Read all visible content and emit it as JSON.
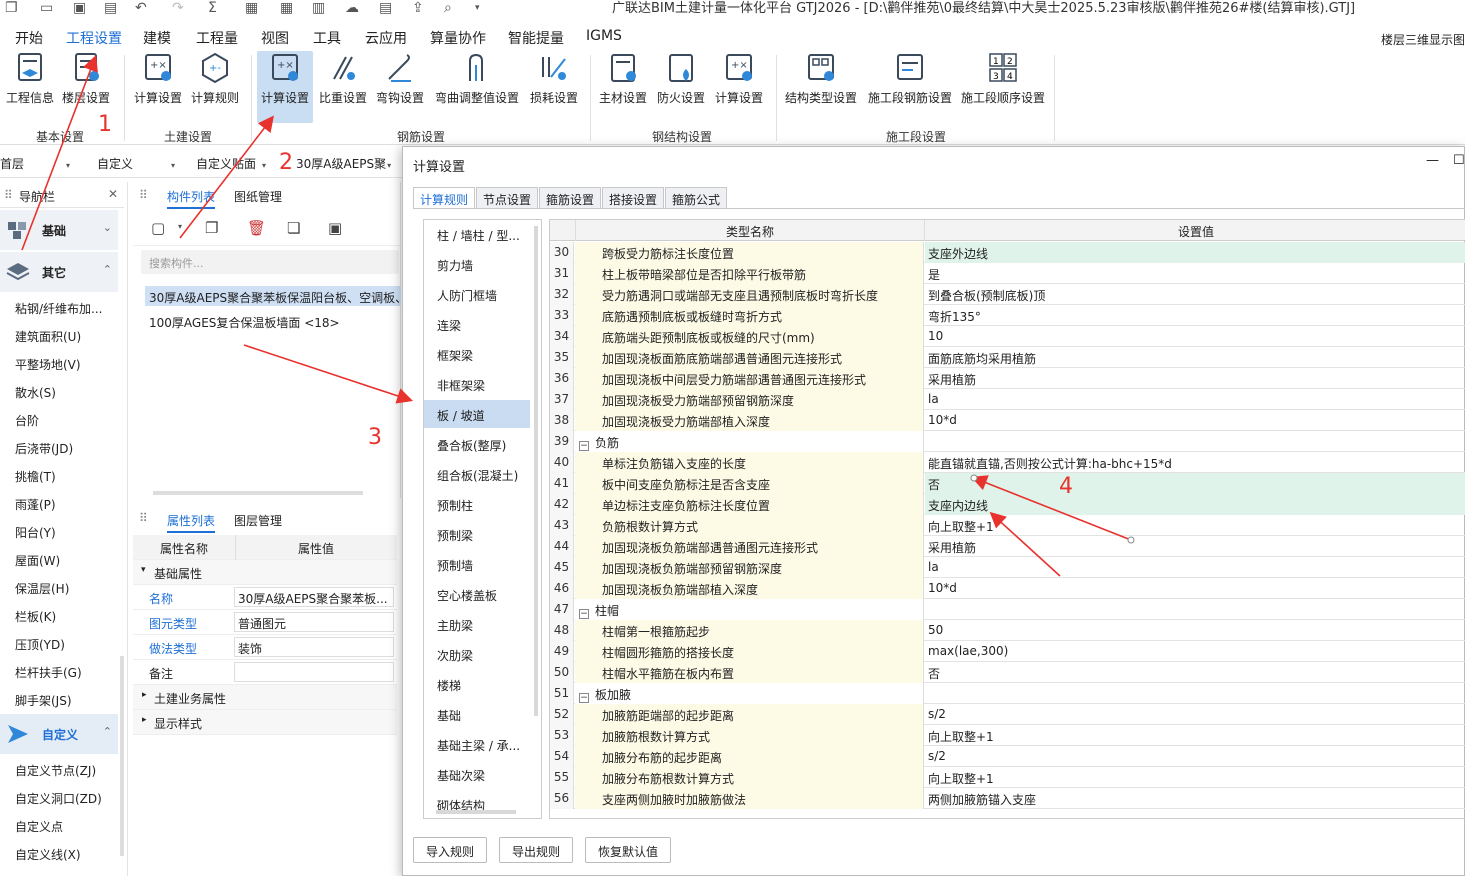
{
  "window": {
    "title": "广联达BIM土建计量一体化平台 GTJ2026 - [D:\\鹳伴推苑\\0最终结算\\中大昊士2025.5.23审核版\\鹳伴推苑26#楼(结算审核).GTJ]"
  },
  "menubar": {
    "items": [
      "开始",
      "工程设置",
      "建模",
      "工程量",
      "视图",
      "工具",
      "云应用",
      "算量协作",
      "智能提量",
      "IGMS"
    ],
    "active": "工程设置",
    "corner": "楼层三维显示图"
  },
  "ribbon": {
    "buttons": [
      {
        "label": "工程信息",
        "icon": "project-info-icon"
      },
      {
        "label": "楼层设置",
        "icon": "floor-settings-icon"
      },
      {
        "label": "计算设置",
        "icon": "calc-settings-icon"
      },
      {
        "label": "计算规则",
        "icon": "calc-rules-icon"
      },
      {
        "label": "计算设置",
        "icon": "rebar-calc-settings-icon"
      },
      {
        "label": "比重设置",
        "icon": "density-settings-icon"
      },
      {
        "label": "弯钩设置",
        "icon": "hook-settings-icon"
      },
      {
        "label": "弯曲调整值设置",
        "icon": "bend-adjust-icon"
      },
      {
        "label": "损耗设置",
        "icon": "loss-settings-icon"
      },
      {
        "label": "主材设置",
        "icon": "main-material-icon"
      },
      {
        "label": "防火设置",
        "icon": "fire-settings-icon"
      },
      {
        "label": "计算设置",
        "icon": "steel-calc-settings-icon"
      },
      {
        "label": "结构类型设置",
        "icon": "structure-type-icon"
      },
      {
        "label": "施工段钢筋设置",
        "icon": "segment-rebar-icon"
      },
      {
        "label": "施工段顺序设置",
        "icon": "segment-order-icon"
      }
    ],
    "groups": [
      "基本设置",
      "土建设置",
      "钢筋设置",
      "钢结构设置",
      "施工段设置"
    ]
  },
  "toolbar2": {
    "floor": "首层",
    "custom": "自定义",
    "custom_face": "自定义贴面",
    "component": "30厚A级AEPS聚"
  },
  "nav": {
    "title": "导航栏",
    "group1": "基础",
    "group2": "其它",
    "items": [
      "粘钢/纤维布加...",
      "建筑面积(U)",
      "平整场地(V)",
      "散水(S)",
      "台阶",
      "后浇带(JD)",
      "挑檐(T)",
      "雨蓬(P)",
      "阳台(Y)",
      "屋面(W)",
      "保温层(H)",
      "栏板(K)",
      "压顶(YD)",
      "栏杆扶手(G)",
      "脚手架(JS)"
    ],
    "group3": "自定义",
    "items2": [
      "自定义节点(ZJ)",
      "自定义洞口(ZD)",
      "自定义点",
      "自定义线(X)"
    ]
  },
  "components": {
    "tab1": "构件列表",
    "tab2": "图纸管理",
    "search_placeholder": "搜索构件...",
    "items": [
      "30厚A级AEPS聚合聚苯板保温阳台板、空调板、",
      "100厚AGES复合保温板墙面 <18>"
    ]
  },
  "properties": {
    "tab1": "属性列表",
    "tab2": "图层管理",
    "col1": "属性名称",
    "col2": "属性值",
    "section": "基础属性",
    "rows": [
      {
        "name": "名称",
        "value": "30厚A级AEPS聚合聚苯板..."
      },
      {
        "name": "图元类型",
        "value": "普通图元"
      },
      {
        "name": "做法类型",
        "value": "装饰"
      },
      {
        "name": "备注",
        "value": ""
      }
    ],
    "sections2": [
      "土建业务属性",
      "显示样式"
    ]
  },
  "dialog": {
    "title": "计算设置",
    "tabs": [
      "计算规则",
      "节点设置",
      "箍筋设置",
      "搭接设置",
      "箍筋公式"
    ],
    "categories": [
      "柱 / 墙柱 / 型...",
      "剪力墙",
      "人防门框墙",
      "连梁",
      "框架梁",
      "非框架梁",
      "板 / 坡道",
      "叠合板(整厚)",
      "组合板(混凝土)",
      "预制柱",
      "预制梁",
      "预制墙",
      "空心楼盖板",
      "主肋梁",
      "次肋梁",
      "楼梯",
      "基础",
      "基础主梁 / 承...",
      "基础次梁",
      "砌体结构"
    ],
    "selected_category": "板 / 坡道",
    "col_name": "类型名称",
    "col_value": "设置值",
    "rows": [
      {
        "n": "30",
        "name": "跨板受力筋标注长度位置",
        "value": "支座外边线",
        "hl": true
      },
      {
        "n": "31",
        "name": "柱上板带暗梁部位是否扣除平行板带筋",
        "value": "是"
      },
      {
        "n": "32",
        "name": "受力筋遇洞口或端部无支座且遇预制底板时弯折长度",
        "value": "到叠合板(预制底板)顶"
      },
      {
        "n": "33",
        "name": "底筋遇预制底板或板缝时弯折方式",
        "value": "弯折135°"
      },
      {
        "n": "34",
        "name": "底筋端头距预制底板或板缝的尺寸(mm)",
        "value": "10"
      },
      {
        "n": "35",
        "name": "加固现浇板面筋底筋端部遇普通图元连接形式",
        "value": "面筋底筋均采用植筋"
      },
      {
        "n": "36",
        "name": "加固现浇板中间层受力筋端部遇普通图元连接形式",
        "value": "采用植筋"
      },
      {
        "n": "37",
        "name": "加固现浇板受力筋端部预留钢筋深度",
        "value": "la"
      },
      {
        "n": "38",
        "name": "加固现浇板受力筋端部植入深度",
        "value": "10*d"
      },
      {
        "n": "39",
        "name": "负筋",
        "value": "",
        "group": true
      },
      {
        "n": "40",
        "name": "单标注负筋锚入支座的长度",
        "value": "能直锚就直锚,否则按公式计算:ha-bhc+15*d"
      },
      {
        "n": "41",
        "name": "板中间支座负筋标注是否含支座",
        "value": "否",
        "hl": true
      },
      {
        "n": "42",
        "name": "单边标注支座负筋标注长度位置",
        "value": "支座内边线",
        "hl": true
      },
      {
        "n": "43",
        "name": "负筋根数计算方式",
        "value": "向上取整+1"
      },
      {
        "n": "44",
        "name": "加固现浇板负筋端部遇普通图元连接形式",
        "value": "采用植筋"
      },
      {
        "n": "45",
        "name": "加固现浇板负筋端部预留钢筋深度",
        "value": "la"
      },
      {
        "n": "46",
        "name": "加固现浇板负筋端部植入深度",
        "value": "10*d"
      },
      {
        "n": "47",
        "name": "柱帽",
        "value": "",
        "group": true
      },
      {
        "n": "48",
        "name": "柱帽第一根箍筋起步",
        "value": "50"
      },
      {
        "n": "49",
        "name": "柱帽圆形箍筋的搭接长度",
        "value": "max(lae,300)"
      },
      {
        "n": "50",
        "name": "柱帽水平箍筋在板内布置",
        "value": "否"
      },
      {
        "n": "51",
        "name": "板加腋",
        "value": "",
        "group": true
      },
      {
        "n": "52",
        "name": "加腋筋距端部的起步距离",
        "value": "s/2"
      },
      {
        "n": "53",
        "name": "加腋筋根数计算方式",
        "value": "向上取整+1"
      },
      {
        "n": "54",
        "name": "加腋分布筋的起步距离",
        "value": "s/2"
      },
      {
        "n": "55",
        "name": "加腋分布筋根数计算方式",
        "value": "向上取整+1"
      },
      {
        "n": "56",
        "name": "支座两侧加腋时加腋筋做法",
        "value": "两侧加腋筋锚入支座"
      }
    ],
    "footer": [
      "导入规则",
      "导出规则",
      "恢复默认值"
    ]
  },
  "annotations": [
    "1",
    "2",
    "3",
    "4"
  ],
  "colors": {
    "accent": "#1e6fd6",
    "annotation": "#e8322d",
    "highlight": "#dff3ea",
    "name_bg": "#fdfbe6"
  }
}
